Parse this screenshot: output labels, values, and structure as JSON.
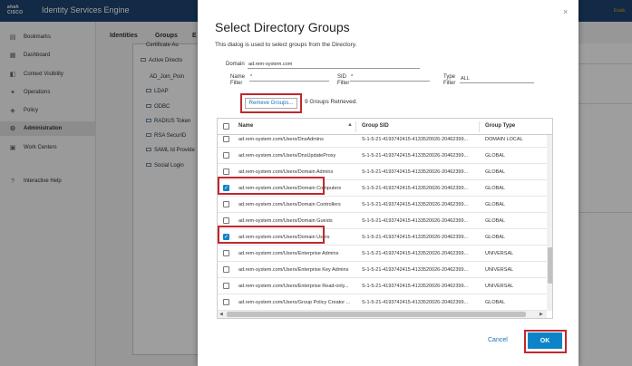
{
  "app": {
    "logo_line1": "ahah",
    "logo_line2": "CISCO",
    "title": "Identity Services Engine",
    "top_right": "Evalu",
    "tabs": [
      "Identities",
      "Groups",
      "E"
    ],
    "sidebar": [
      {
        "label": "Bookmarks",
        "icon": "bookmark-icon"
      },
      {
        "label": "Dashboard",
        "icon": "dashboard-icon"
      },
      {
        "label": "Context Visibility",
        "icon": "visibility-icon"
      },
      {
        "label": "Operations",
        "icon": "operations-icon"
      },
      {
        "label": "Policy",
        "icon": "policy-icon"
      },
      {
        "label": "Administration",
        "icon": "administration-icon"
      },
      {
        "label": "Work Centers",
        "icon": "work-centers-icon"
      },
      {
        "label": "Interactive Help",
        "icon": "help-icon"
      }
    ],
    "tree": [
      "Certificate Au",
      "Active Directo",
      "AD_Join_Poin",
      "LDAP",
      "ODBC",
      "RADIUS Token",
      "RSA SecurID",
      "SAML Id Provide",
      "Social Login"
    ]
  },
  "dialog": {
    "title": "Select Directory Groups",
    "description": "This dialog is used to select groups from the Directory.",
    "close_symbol": "×",
    "domain_label": "Domain",
    "domain_value": "ad.rem-system.com",
    "name_filter_label_1": "Name",
    "name_filter_label_2": "Filter",
    "name_filter_value": "*",
    "sid_filter_label_1": "SID",
    "sid_filter_label_2": "Filter",
    "sid_filter_value": "*",
    "type_filter_label_1": "Type",
    "type_filter_label_2": "Filter",
    "type_filter_value": "ALL",
    "remove_button": "Remeve Groups...",
    "retrieved_text": "9 Groups Retrieved.",
    "columns": {
      "name": "Name",
      "sid": "Group SID",
      "type": "Group Type"
    },
    "rows": [
      {
        "name": "ad.rem-system.com/Users/DnsAdmins",
        "sid": "S-1-5-21-4193742415-4133520026-20462399...",
        "type": "DOMAIN LOCAL",
        "checked": false
      },
      {
        "name": "ad.rem-system.com/Users/DnsUpdateProxy",
        "sid": "S-1-5-21-4193742415-4133520026-20462399...",
        "type": "GLOBAL",
        "checked": false
      },
      {
        "name": "ad.rem-system.com/Users/Domain Admins",
        "sid": "S-1-5-21-4193742415-4133520026-20462399...",
        "type": "GLOBAL",
        "checked": false
      },
      {
        "name": "ad.rem-system.com/Users/Domain Computers",
        "sid": "S-1-5-21-4193742415-4133520026-20462399...",
        "type": "GLOBAL",
        "checked": true
      },
      {
        "name": "ad.rem-system.com/Users/Domain Controllers",
        "sid": "S-1-5-21-4193742415-4133520026-20462399...",
        "type": "GLOBAL",
        "checked": false
      },
      {
        "name": "ad.rem-system.com/Users/Domain Guests",
        "sid": "S-1-5-21-4193742415-4133520026-20462399...",
        "type": "GLOBAL",
        "checked": false
      },
      {
        "name": "ad.rem-system.com/Users/Domain Users",
        "sid": "S-1-5-21-4193742415-4133520026-20462399...",
        "type": "GLOBAL",
        "checked": true
      },
      {
        "name": "ad.rem-system.com/Users/Enterprise Admins",
        "sid": "S-1-5-21-4193742415-4133520026-20462399...",
        "type": "UNIVERSAL",
        "checked": false
      },
      {
        "name": "ad.rem-system.com/Users/Enterprise Key Admins",
        "sid": "S-1-5-21-4193742415-4133520026-20462399...",
        "type": "UNIVERSAL",
        "checked": false
      },
      {
        "name": "ad.rem-system.com/Users/Enterprise Read-only...",
        "sid": "S-1-5-21-4193742415-4133520026-20462399...",
        "type": "UNIVERSAL",
        "checked": false
      },
      {
        "name": "ad.rem-system.com/Users/Group Policy Creator ...",
        "sid": "S-1-5-21-4193742415-4133520026-20462399...",
        "type": "GLOBAL",
        "checked": false
      }
    ],
    "cancel_button": "Cancel",
    "ok_button": "OK"
  },
  "colors": {
    "accent": "#0d84c8",
    "header": "#1e4471",
    "highlight": "#c0282e"
  }
}
